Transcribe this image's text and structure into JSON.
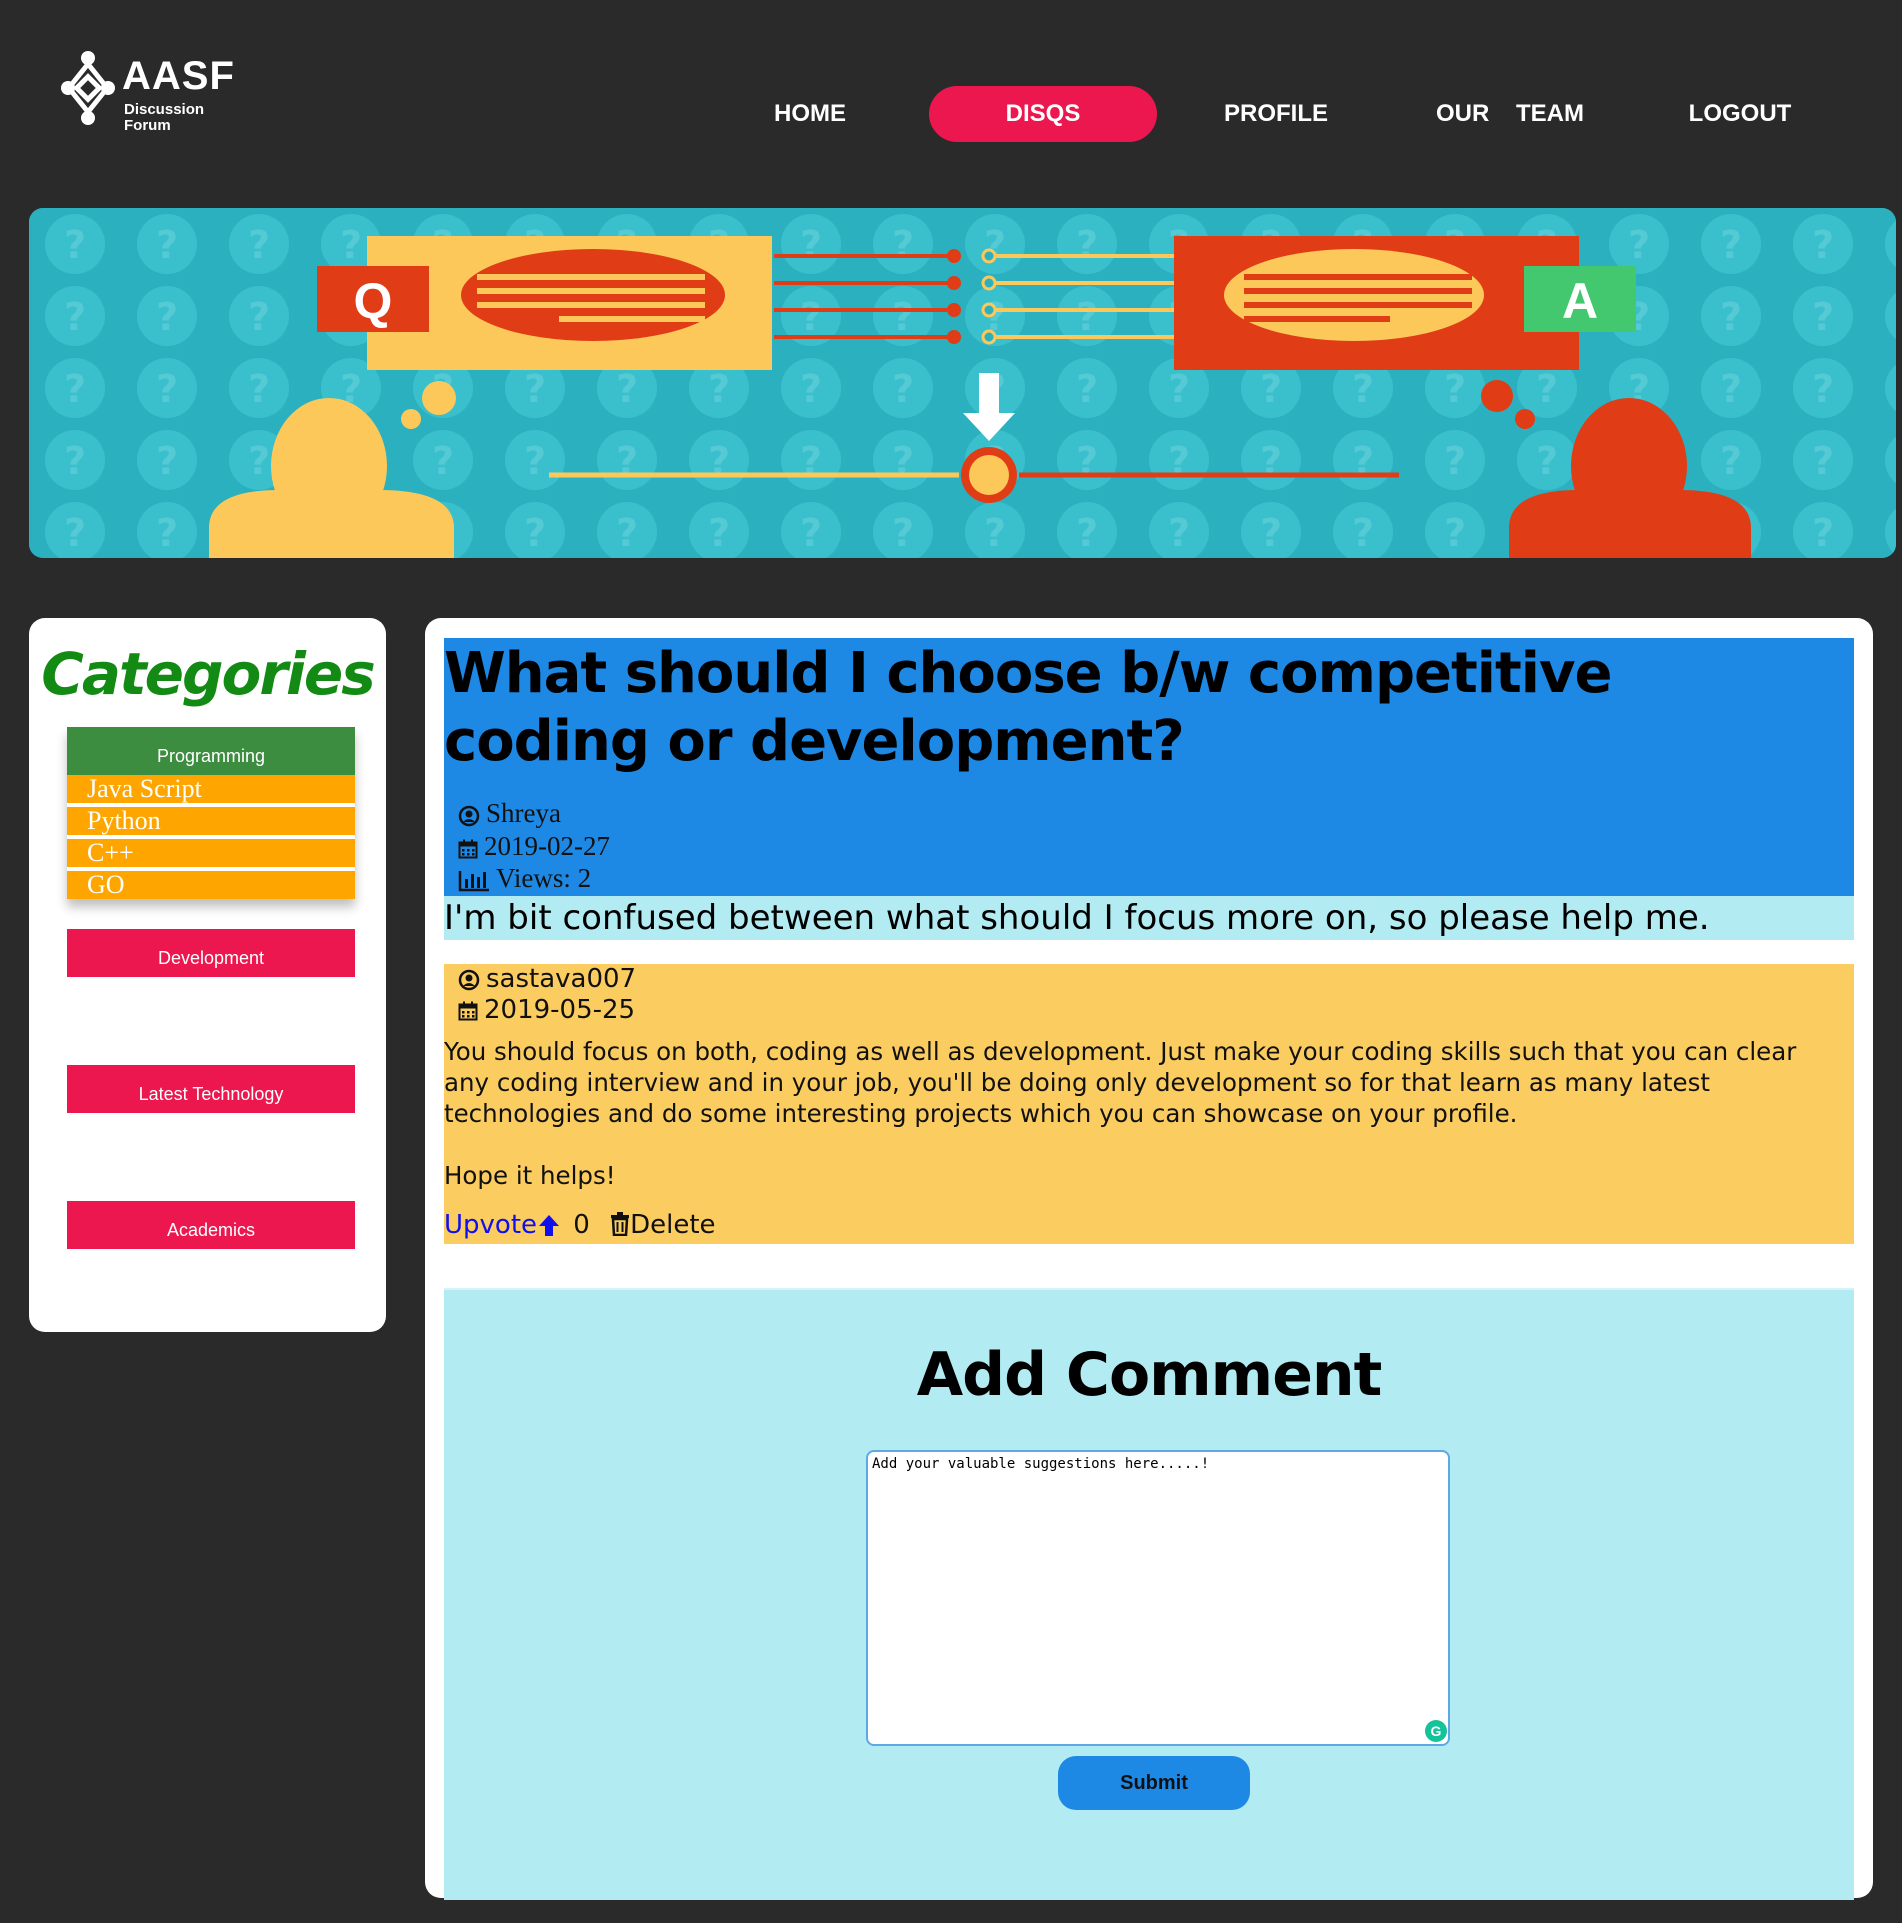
{
  "logo": {
    "title": "AASF",
    "subtitle": "Discussion Forum"
  },
  "nav": {
    "items": [
      {
        "label": "HOME"
      },
      {
        "label": "DISQS",
        "active": true
      },
      {
        "label": "PROFILE"
      },
      {
        "label": "OUR    TEAM"
      },
      {
        "label": "LOGOUT"
      }
    ]
  },
  "banner": {
    "q_letter": "Q",
    "a_letter": "A"
  },
  "sidebar": {
    "title": "Categories",
    "categories": [
      {
        "label": "Programming",
        "color": "#3c8d3f",
        "subcategories": [
          "Java Script",
          "Python",
          "C++",
          "GO"
        ]
      },
      {
        "label": "Development",
        "color": "#ec174e"
      },
      {
        "label": "Latest Technology",
        "color": "#ec174e"
      },
      {
        "label": "Academics",
        "color": "#ec174e"
      }
    ]
  },
  "question": {
    "title": "What should I choose b/w competitive coding or development?",
    "author": "Shreya",
    "date": "2019-02-27",
    "views": "Views: 2",
    "description": "I'm bit confused between what should I focus more on, so please help me."
  },
  "answer": {
    "author": "sastava007",
    "date": "2019-05-25",
    "text": "You should focus on both, coding as well as development. Just make your coding skills such that you can clear any coding interview and in your job, you'll be doing only development so for that learn as many latest technologies and do some interesting projects which you can showcase on your profile.\n\nHope it helps!",
    "upvote_label": "Upvote",
    "upvote_count": "0",
    "delete_label": "Delete"
  },
  "comment": {
    "title": "Add Comment",
    "placeholder": "Add your valuable suggestions here.....!",
    "submit_label": "Submit"
  },
  "colors": {
    "background": "#2a2a2a",
    "accent": "#ec174e",
    "question_header": "#1e88e5",
    "description_bg": "#b2ebf2",
    "answer_bg": "#fbcc5f",
    "category_green": "#3c8d3f",
    "subcategory_orange": "#ffa500"
  }
}
